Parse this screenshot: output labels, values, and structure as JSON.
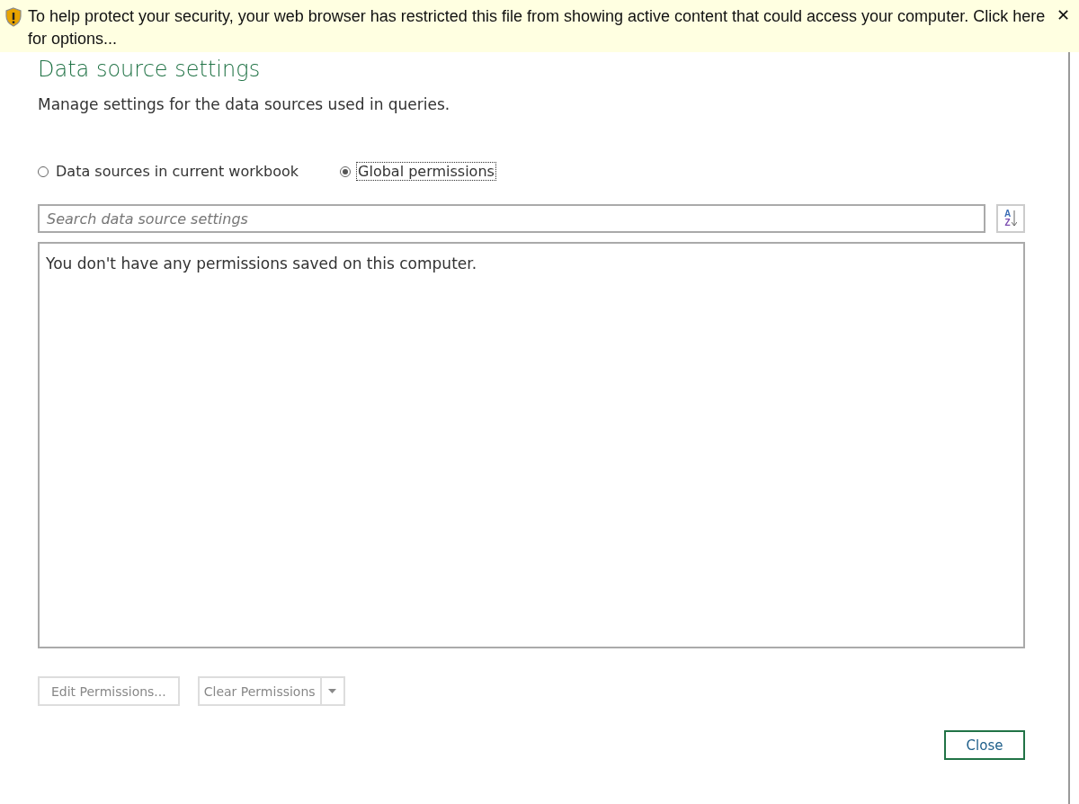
{
  "info_bar": {
    "message": "To help protect your security, your web browser has restricted this file from showing active content that could access your computer. Click here for options...",
    "close": "✕"
  },
  "dialog": {
    "title": "Data source settings",
    "description": "Manage settings for the data sources used in queries."
  },
  "scope_options": [
    {
      "label": "Data sources in current workbook",
      "selected": false
    },
    {
      "label": "Global permissions",
      "selected": true
    }
  ],
  "search": {
    "placeholder": "Search data source settings"
  },
  "sort_button": {
    "letters": [
      "A",
      "Z"
    ]
  },
  "list": {
    "empty_message": "You don't have any permissions saved on this computer."
  },
  "actions": [
    {
      "kind": "plain",
      "label": "Edit Permissions...",
      "disabled": true
    },
    {
      "kind": "split",
      "label": "Clear Permissions",
      "disabled": true
    }
  ],
  "footer": {
    "close_label": "Close"
  }
}
